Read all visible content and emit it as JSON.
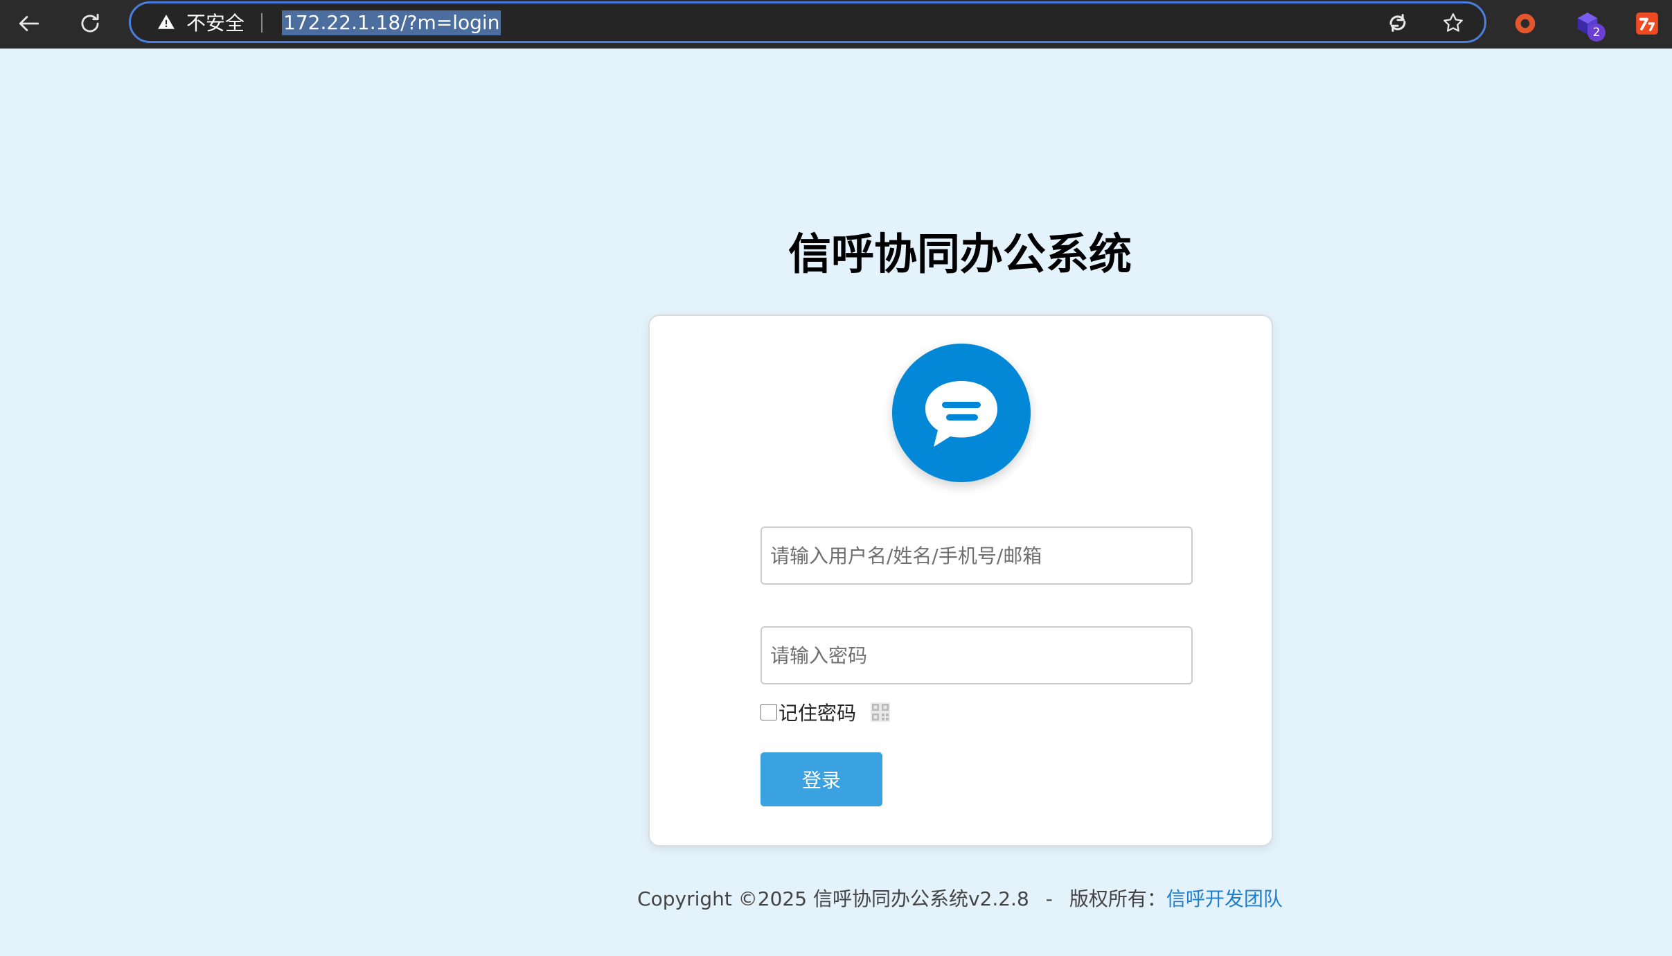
{
  "browser": {
    "security_label": "不安全",
    "url": "172.22.1.18/?m=login",
    "extension_badge": "2",
    "icons": {
      "back": "arrow-left-icon",
      "reload": "reload-icon",
      "warning": "warning-triangle-icon",
      "reader": "edge-refresh-icon",
      "favorite": "star-icon"
    }
  },
  "page": {
    "title": "信呼协同办公系统"
  },
  "login": {
    "username_placeholder": "请输入用户名/姓名/手机号/邮箱",
    "username_value": "",
    "password_placeholder": "请输入密码",
    "password_value": "",
    "remember_label": "记住密码",
    "remember_checked": false,
    "submit_label": "登录"
  },
  "footer": {
    "copyright": "Copyright ©2025 信呼协同办公系统v2.2.8",
    "separator": "-",
    "rights_label": "版权所有：",
    "team_link": "信呼开发团队"
  },
  "colors": {
    "page_background": "#e4f2fb",
    "brand_blue": "#0288d7",
    "button_blue": "#3ba2e2",
    "link_blue": "#1f7fcf"
  }
}
